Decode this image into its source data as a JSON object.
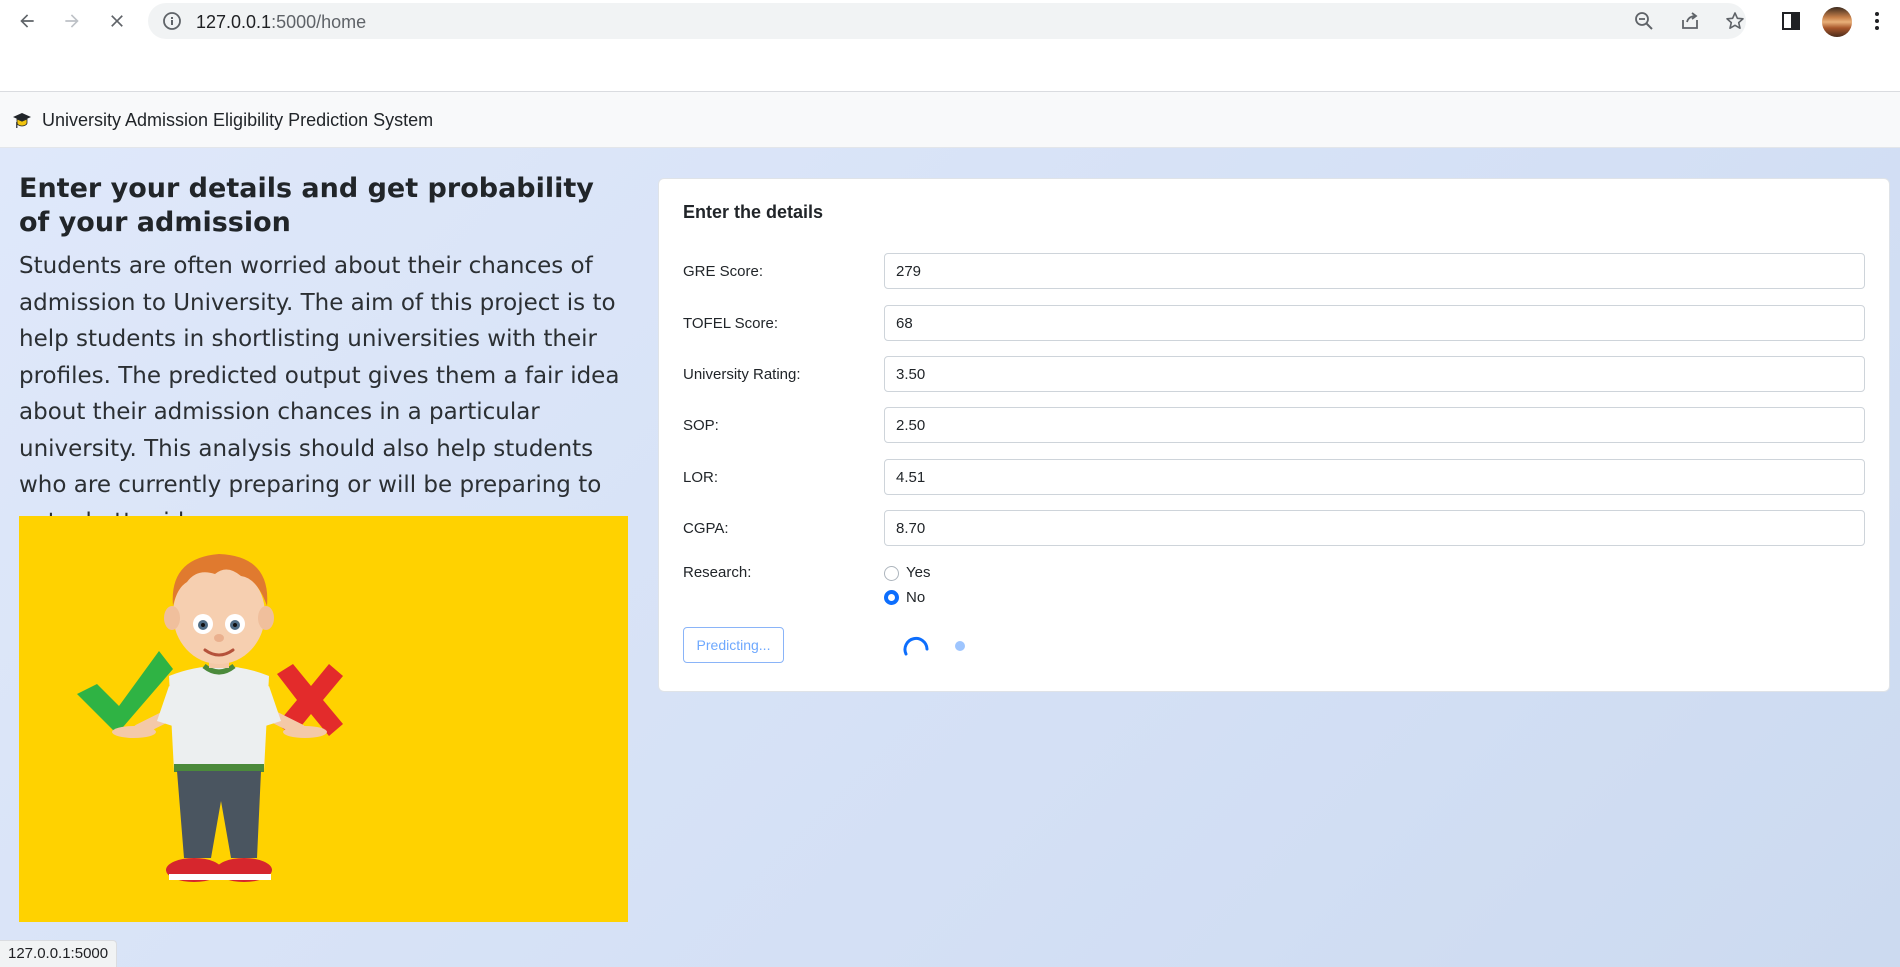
{
  "browser": {
    "url_host": "127.0.0.1",
    "url_rest": ":5000/home",
    "status_url": "127.0.0.1:5000"
  },
  "navbar": {
    "brand": "University Admission Eligibility Prediction System"
  },
  "intro": {
    "heading": "Enter your details and get probability of your admission",
    "paragraph": "Students are often worried about their chances of admission to University. The aim of this project is to help students in shortlisting universities with their profiles. The predicted output gives them a fair idea about their admission chances in a particular university. This analysis should also help students who are currently preparing or will be preparing to get a better idea."
  },
  "form": {
    "title": "Enter the details",
    "fields": [
      {
        "label": "GRE Score:",
        "value": "279"
      },
      {
        "label": "TOFEL Score:",
        "value": "68"
      },
      {
        "label": "University Rating:",
        "value": "3.50"
      },
      {
        "label": "SOP:",
        "value": "2.50"
      },
      {
        "label": "LOR:",
        "value": "4.51"
      },
      {
        "label": "CGPA:",
        "value": "8.70"
      }
    ],
    "research": {
      "label": "Research:",
      "options": [
        "Yes",
        "No"
      ],
      "selected": "No"
    },
    "submit_label": "Predicting..."
  },
  "colors": {
    "accent": "#0d6efd",
    "illustration_bg": "#ffd200"
  }
}
